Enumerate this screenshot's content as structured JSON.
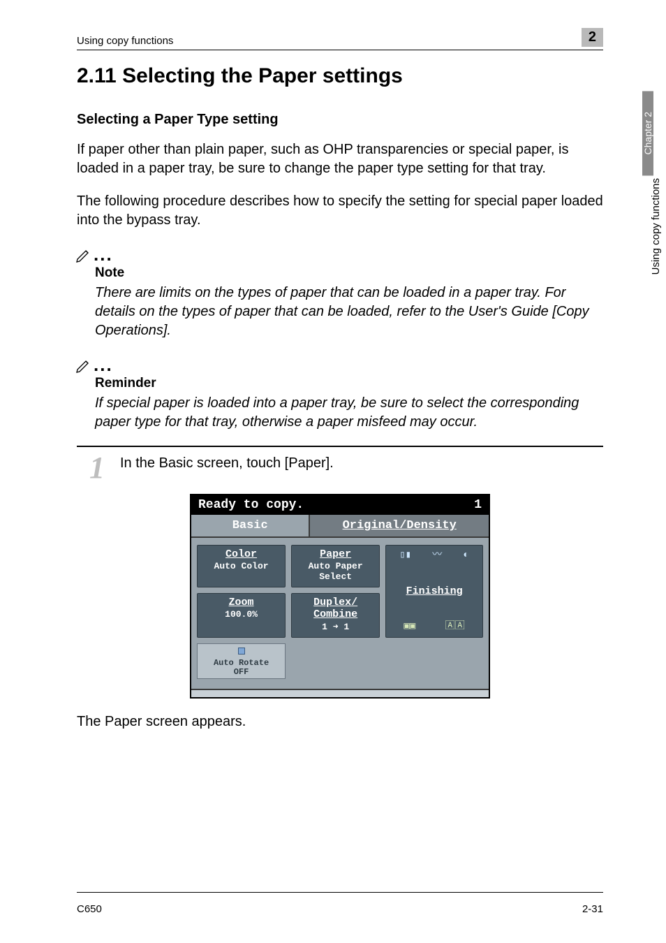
{
  "running_head": {
    "left": "Using copy functions",
    "chapter_number": "2"
  },
  "section": {
    "number_title": "2.11   Selecting the Paper settings",
    "subheading": "Selecting a Paper Type setting",
    "para1": "If paper other than plain paper, such as OHP transparencies or special paper, is loaded in a paper tray, be sure to change the paper type setting for that tray.",
    "para2": "The following procedure describes how to specify the setting for special paper loaded into the bypass tray."
  },
  "notes": [
    {
      "title": "Note",
      "body": "There are limits on the types of paper that can be loaded in a paper tray. For details on the types of paper that can be loaded, refer to the User's Guide [Copy Operations]."
    },
    {
      "title": "Reminder",
      "body": "If special paper is loaded into a paper tray, be sure to select the corresponding paper type for that tray, otherwise a paper misfeed may occur."
    }
  ],
  "step": {
    "number": "1",
    "text": "In the Basic screen, touch [Paper].",
    "after_text": "The Paper screen appears."
  },
  "panel": {
    "title_left": "Ready to copy.",
    "title_right": "1",
    "tabs": {
      "active": "Basic",
      "inactive": "Original/Density"
    },
    "color": {
      "header": "Color",
      "value": "Auto Color"
    },
    "paper": {
      "header": "Paper",
      "value": "Auto Paper\nSelect"
    },
    "zoom": {
      "header": "Zoom",
      "value": "100.0%"
    },
    "duplex": {
      "header": "Duplex/\nCombine",
      "value": "1 ➜ 1"
    },
    "finishing": "Finishing",
    "auto_rotate": "Auto Rotate\nOFF"
  },
  "side": {
    "tab": "Chapter 2",
    "label": "Using copy functions"
  },
  "footer": {
    "left": "C650",
    "right": "2-31"
  }
}
